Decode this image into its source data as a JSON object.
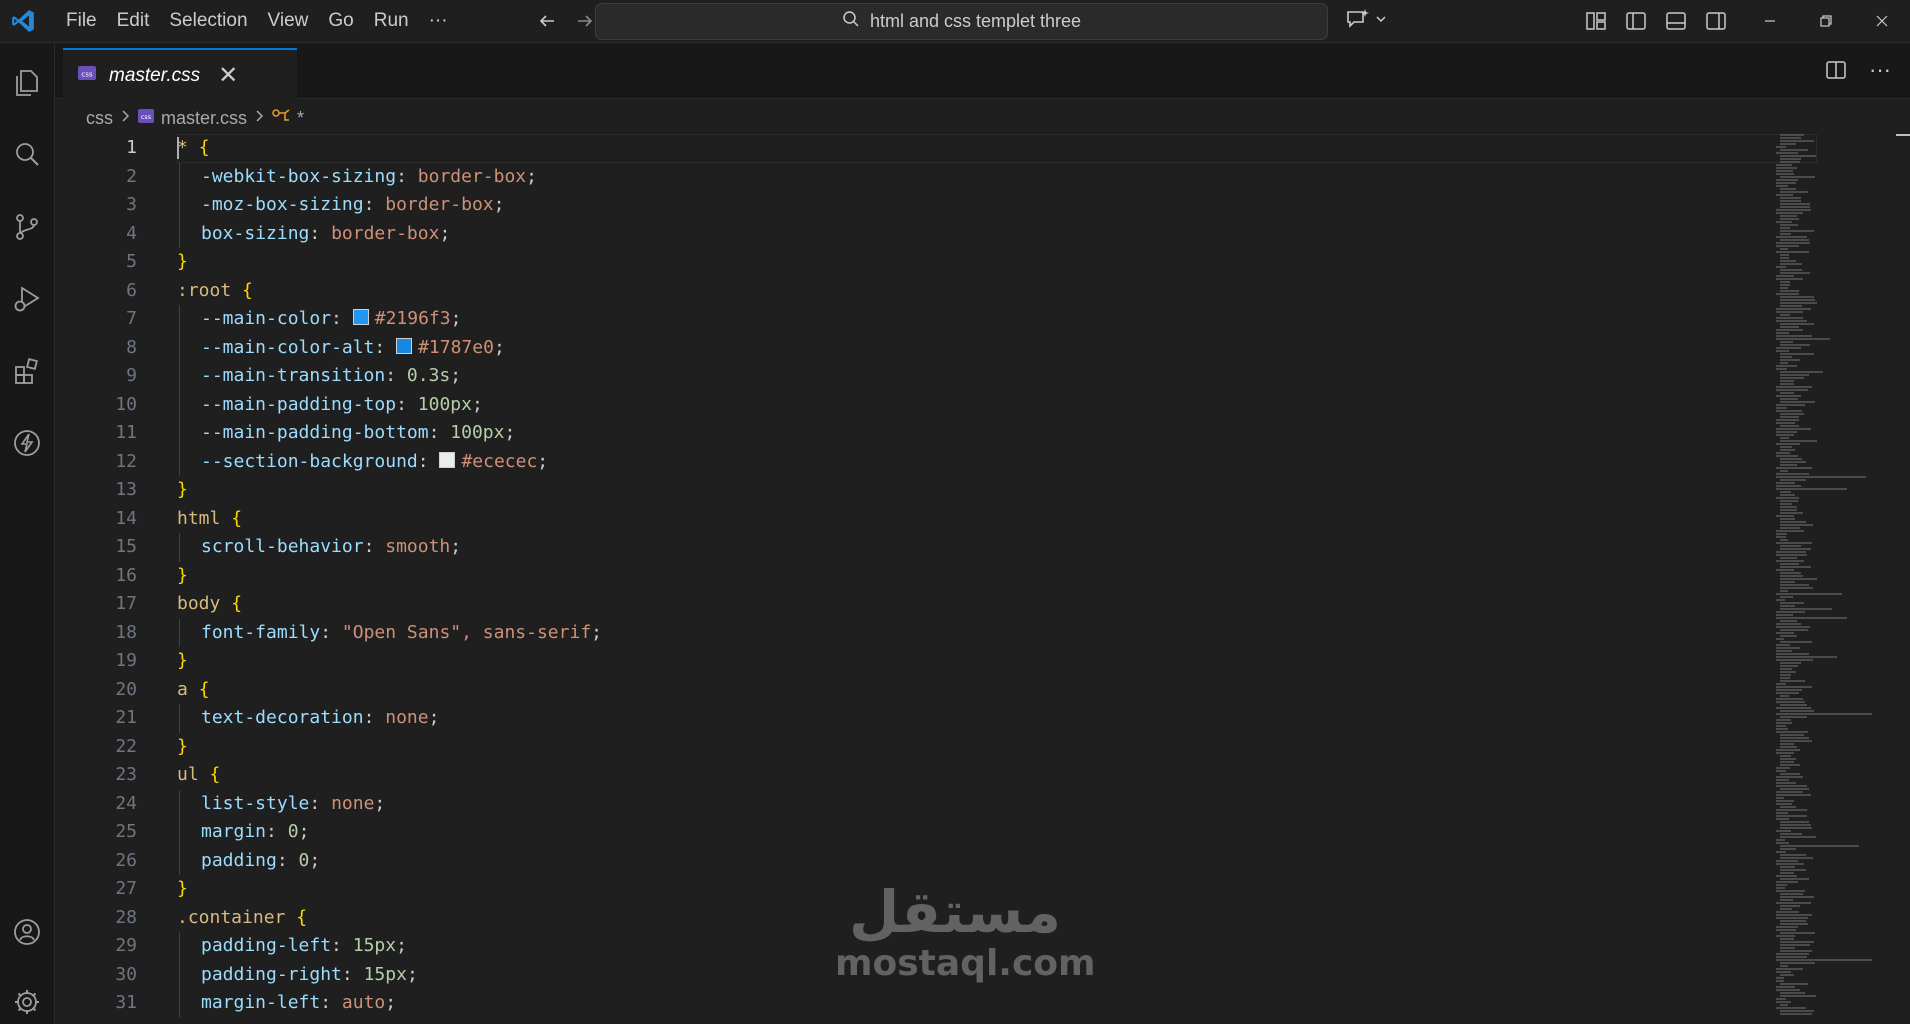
{
  "titlebar": {
    "menu": [
      "File",
      "Edit",
      "Selection",
      "View",
      "Go",
      "Run",
      "···"
    ],
    "search_text": "html and css templet three",
    "icons": [
      "vscode-logo-icon",
      "back-arrow-icon",
      "forward-arrow-icon",
      "search-icon",
      "copilot-icon",
      "chevron-down-icon",
      "customize-layout-icon",
      "toggle-primary-sidebar-icon",
      "toggle-panel-icon",
      "toggle-secondary-sidebar-icon",
      "minimize-icon",
      "maximize-icon",
      "close-icon"
    ]
  },
  "activitybar": {
    "items": [
      "explorer-icon",
      "search-icon",
      "source-control-icon",
      "run-debug-icon",
      "extensions-icon",
      "lightning-icon",
      "accounts-icon",
      "manage-gear-icon"
    ]
  },
  "tab": {
    "label": "master.css",
    "close": "✕"
  },
  "tab_actions": {
    "split": "split-editor-icon",
    "more": "···"
  },
  "breadcrumb": {
    "folder": "css",
    "file": "master.css",
    "symbol": "*"
  },
  "editor": {
    "current_line": 1,
    "line_numbers": [
      "1",
      "2",
      "3",
      "4",
      "5",
      "6",
      "7",
      "8",
      "9",
      "10",
      "11",
      "12",
      "13",
      "14",
      "15",
      "16",
      "17",
      "18",
      "19",
      "20",
      "21",
      "22",
      "23",
      "24",
      "25",
      "26",
      "27",
      "28",
      "29",
      "30",
      "31"
    ],
    "colors": {
      "main_color": "#2196f3",
      "main_color_alt": "#1787e0",
      "section_background": "#ececec"
    },
    "lines": [
      {
        "sel": "* ",
        "brace": "{"
      },
      {
        "prop": "-webkit-box-sizing",
        "val": "border-box"
      },
      {
        "prop": "-moz-box-sizing",
        "val": "border-box"
      },
      {
        "prop": "box-sizing",
        "val": "border-box"
      },
      {
        "brace": "}"
      },
      {
        "sel": ":root ",
        "brace": "{"
      },
      {
        "prop": "--main-color",
        "val": "#2196f3"
      },
      {
        "prop": "--main-color-alt",
        "val": "#1787e0"
      },
      {
        "prop": "--main-transition",
        "val": "0.3s"
      },
      {
        "prop": "--main-padding-top",
        "val": "100px"
      },
      {
        "prop": "--main-padding-bottom",
        "val": "100px"
      },
      {
        "prop": "--section-background",
        "val": "#ececec"
      },
      {
        "brace": "}"
      },
      {
        "sel": "html ",
        "brace": "{"
      },
      {
        "prop": "scroll-behavior",
        "val": "smooth"
      },
      {
        "brace": "}"
      },
      {
        "sel": "body ",
        "brace": "{"
      },
      {
        "prop": "font-family",
        "val": "\"Open Sans\", sans-serif"
      },
      {
        "brace": "}"
      },
      {
        "sel": "a ",
        "brace": "{"
      },
      {
        "prop": "text-decoration",
        "val": "none"
      },
      {
        "brace": "}"
      },
      {
        "sel": "ul ",
        "brace": "{"
      },
      {
        "prop": "list-style",
        "val": "none"
      },
      {
        "prop": "margin",
        "val": "0"
      },
      {
        "prop": "padding",
        "val": "0"
      },
      {
        "brace": "}"
      },
      {
        "sel": ".container ",
        "brace": "{"
      },
      {
        "prop": "padding-left",
        "val": "15px"
      },
      {
        "prop": "padding-right",
        "val": "15px"
      },
      {
        "prop": "margin-left",
        "val": "auto"
      }
    ]
  },
  "watermark": {
    "arabic": "مستقل",
    "latin": "mostaql.com"
  }
}
